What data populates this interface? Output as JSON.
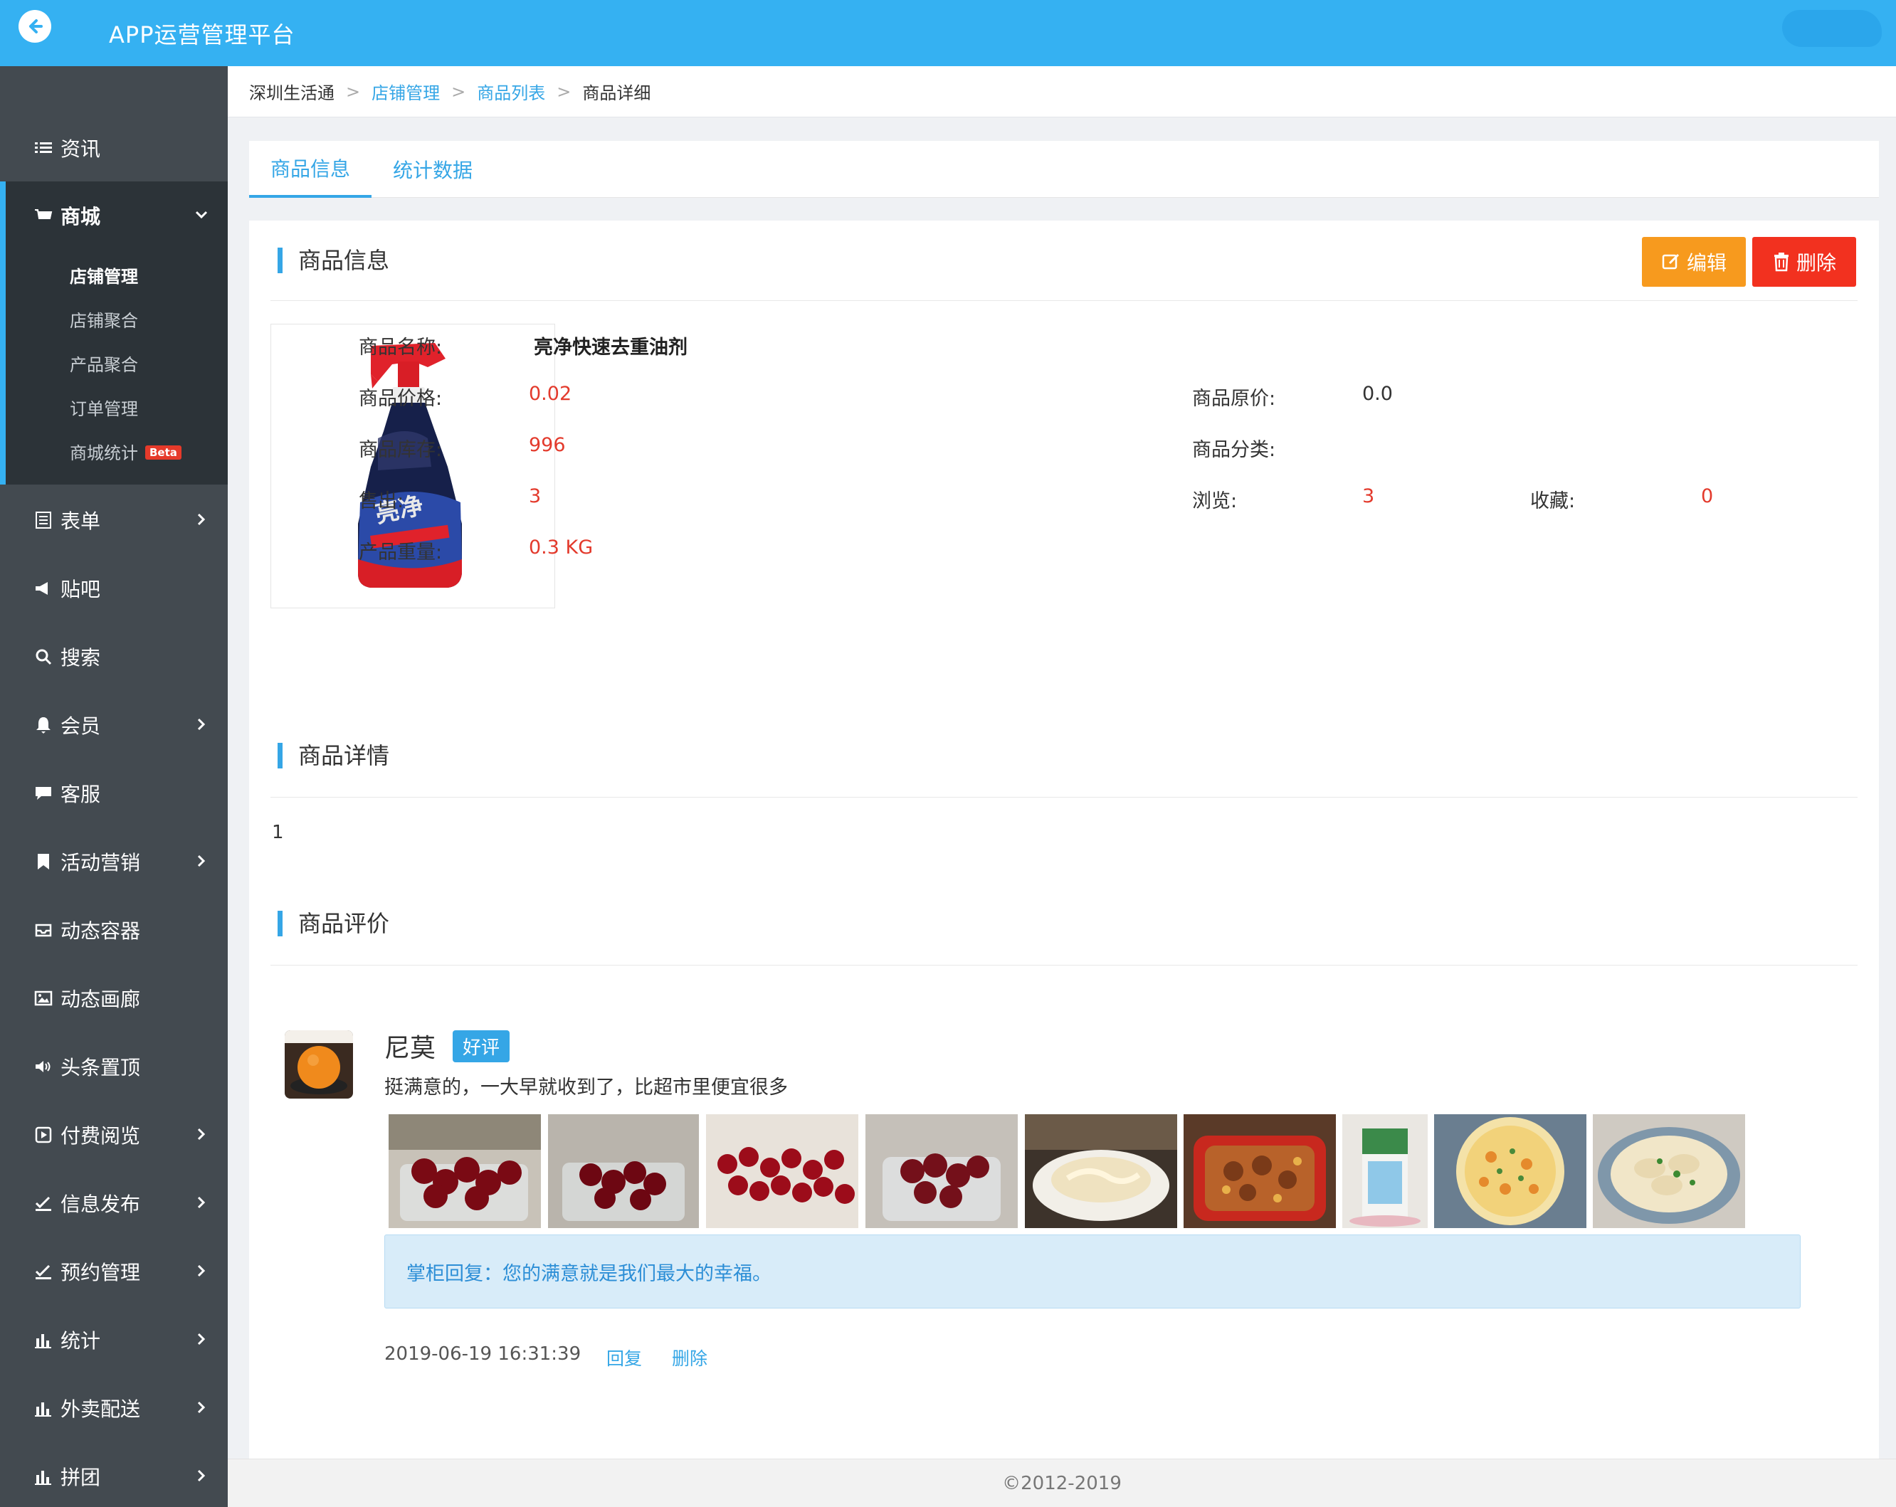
{
  "header": {
    "title": "APP运营管理平台",
    "back_icon": "back-arrow-icon"
  },
  "sidebar": {
    "items": [
      {
        "label": "资讯",
        "icon": "list-icon"
      },
      {
        "label": "商城",
        "icon": "cart-icon",
        "active": true
      },
      {
        "label": "表单",
        "icon": "form-icon"
      },
      {
        "label": "贴吧",
        "icon": "megaphone-icon"
      },
      {
        "label": "搜索",
        "icon": "search-icon"
      },
      {
        "label": "会员",
        "icon": "bell-icon"
      },
      {
        "label": "客服",
        "icon": "chat-icon"
      },
      {
        "label": "活动营销",
        "icon": "bookmark-icon"
      },
      {
        "label": "动态容器",
        "icon": "inbox-icon"
      },
      {
        "label": "动态画廊",
        "icon": "picture-icon"
      },
      {
        "label": "头条置顶",
        "icon": "volume-icon"
      },
      {
        "label": "付费阅览",
        "icon": "play-square-icon"
      },
      {
        "label": "信息发布",
        "icon": "check-edit-icon"
      },
      {
        "label": "预约管理",
        "icon": "check-edit-icon"
      },
      {
        "label": "统计",
        "icon": "bar-chart-icon"
      },
      {
        "label": "外卖配送",
        "icon": "bar-chart-icon"
      },
      {
        "label": "拼团",
        "icon": "bar-chart-icon"
      }
    ],
    "sub_items": [
      {
        "label": "店铺管理",
        "active": true
      },
      {
        "label": "店铺聚合"
      },
      {
        "label": "产品聚合"
      },
      {
        "label": "订单管理"
      },
      {
        "label": "商城统计",
        "badge": "Beta"
      }
    ]
  },
  "breadcrumb": {
    "home": "深圳生活通",
    "sep": ">",
    "level1": "店铺管理",
    "level2": "商品列表",
    "current": "商品详细"
  },
  "tabs": [
    {
      "label": "商品信息",
      "active": true
    },
    {
      "label": "统计数据"
    }
  ],
  "product": {
    "section_title": "商品信息",
    "edit_label": "编辑",
    "delete_label": "删除",
    "name_label": "商品名称:",
    "name": "亮净快速去重油剂",
    "price_label": "商品价格:",
    "price": "0.02",
    "orig_price_label": "商品原价:",
    "orig_price": "0.0",
    "stock_label": "商品库存:",
    "stock": "996",
    "category_label": "商品分类:",
    "category": "",
    "sold_label": "售出:",
    "sold": "3",
    "views_label": "浏览:",
    "views": "3",
    "fav_label": "收藏:",
    "fav": "0",
    "weight_label": "产品重量:",
    "weight": "0.3 KG",
    "image_icon": "spray-bottle-image"
  },
  "details": {
    "section_title": "商品详情",
    "content": "1"
  },
  "reviews": {
    "section_title": "商品评价",
    "list": [
      {
        "name": "尼莫",
        "badge": "好评",
        "text": "挺满意的，一大早就收到了，比超市里便宜很多",
        "reply": "掌柜回复：您的满意就是我们最大的幸福。",
        "time": "2019-06-19 16:31:39",
        "reply_action": "回复",
        "delete_action": "删除",
        "photos": [
          "cherries-photo",
          "cherries-photo",
          "cherries-photo",
          "cherries-photo",
          "noodles-photo",
          "stew-photo",
          "milk-carton-photo",
          "pizza-photo",
          "dumplings-photo"
        ]
      }
    ]
  },
  "footer": {
    "copyright": "©2012-2019"
  },
  "colors": {
    "primary": "#35b1f2",
    "accent": "#35a6e6",
    "sidebar": "#434a50",
    "warning": "#f79a1e",
    "danger": "#f2311f",
    "value_red": "#e33a2c"
  }
}
